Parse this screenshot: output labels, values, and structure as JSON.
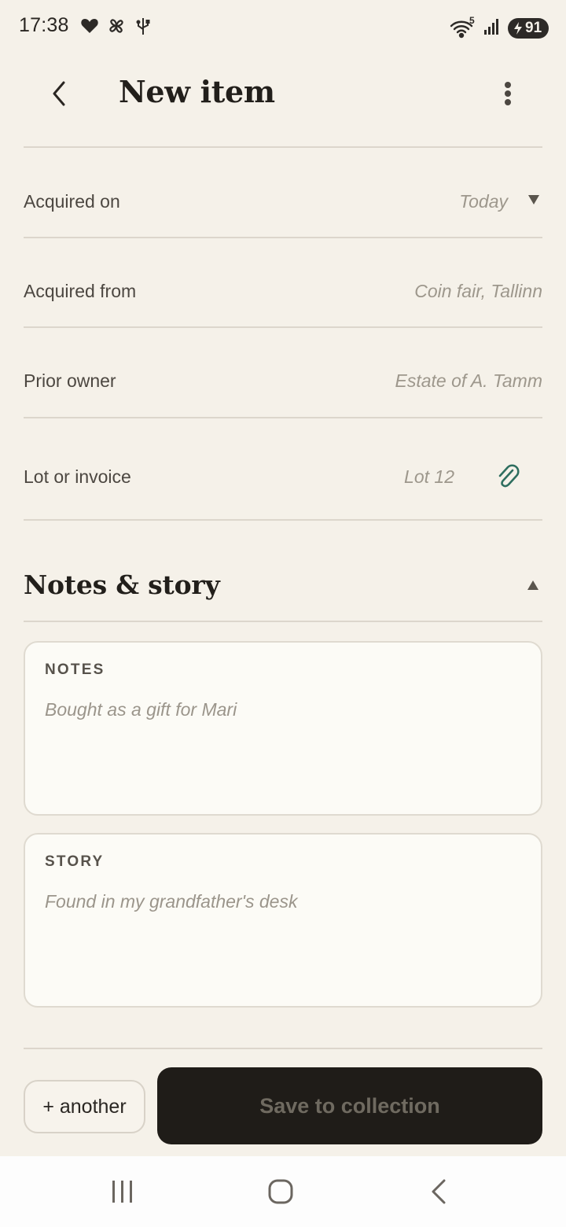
{
  "status_bar": {
    "time": "17:38",
    "battery_level": "91",
    "network_badge": "5",
    "left_icons": [
      "heart-icon",
      "pinwheel-icon",
      "usb-icon"
    ],
    "right_icons": [
      "wifi-icon",
      "signal-icon",
      "battery-icon",
      "charging-bolt-icon"
    ]
  },
  "header": {
    "title": "New item",
    "back_icon": "chevron-left-icon",
    "menu_icon": "more-vertical-icon"
  },
  "fields": [
    {
      "label": "Acquired on",
      "value": "Today",
      "control": "dropdown"
    },
    {
      "label": "Acquired from",
      "value": "Coin fair, Tallinn"
    },
    {
      "label": "Prior owner",
      "value": "Estate of A. Tamm"
    },
    {
      "label": "Lot or invoice",
      "value": "Lot 12",
      "control": "paperclip-icon"
    }
  ],
  "notes_section": {
    "title": "Notes & story",
    "expanded": true,
    "notes": {
      "label": "NOTES",
      "text": "Bought as a gift for Mari"
    },
    "story": {
      "label": "STORY",
      "text": "Found in my grandfather's desk"
    }
  },
  "footer": {
    "another_label": "+ another",
    "save_label": "Save to collection",
    "save_enabled": false
  },
  "nav_bar": {
    "icons": [
      "recents-icon",
      "home-icon",
      "back-icon"
    ]
  },
  "colors": {
    "background": "#f5f1e9",
    "accent": "#2e6e5f",
    "save_button": "#1f1c18",
    "muted_text": "#9d978c"
  }
}
